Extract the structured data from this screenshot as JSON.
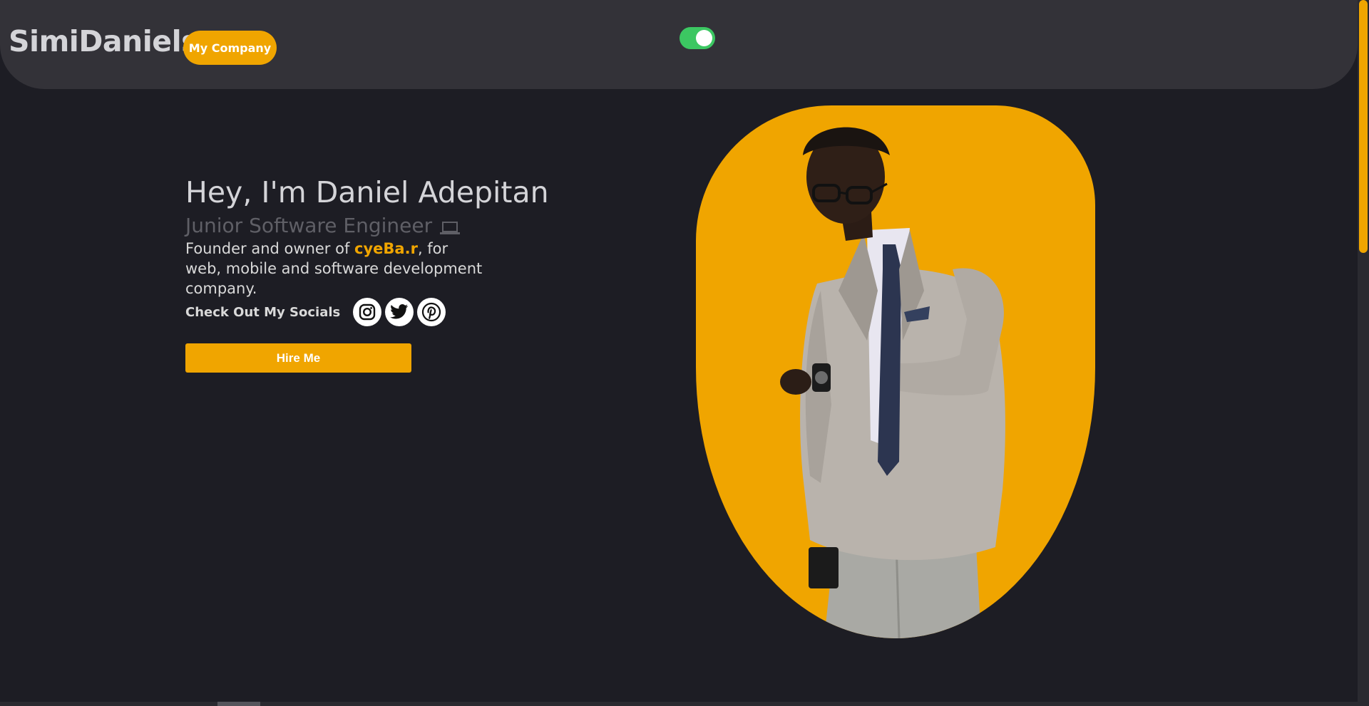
{
  "nav": {
    "logo": "SimiDaniels",
    "company_button": "My Company",
    "theme_toggle": {
      "state": "on",
      "color": "#3cc762"
    }
  },
  "hero": {
    "title": "Hey, I'm Daniel Adepitan",
    "subtitle": "Junior Software Engineer",
    "subtitle_icon": "laptop-icon",
    "desc_before": "Founder and owner of ",
    "brand": "cyeBa.r",
    "desc_after": ", for web, mobile and software development company.",
    "socials_label": "Check Out My Socials",
    "socials": [
      "instagram-icon",
      "twitter-icon",
      "pinterest-icon"
    ],
    "hire_button": "Hire Me",
    "portrait": "portrait of a man in a grey suit checking his watch"
  },
  "colors": {
    "accent": "#f0a500",
    "background": "#1d1d24",
    "navbar": "#333238"
  }
}
